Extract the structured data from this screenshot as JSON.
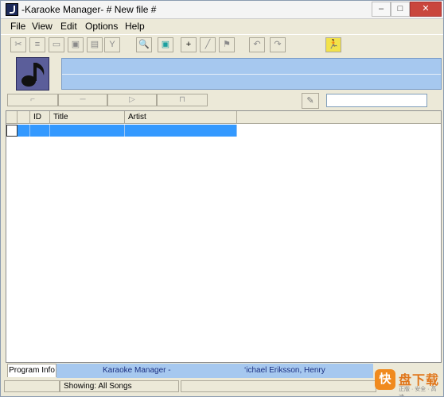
{
  "window": {
    "title": "-Karaoke Manager- # New file #",
    "controls": {
      "minimize": "–",
      "maximize": "□",
      "close": "✕"
    }
  },
  "menu": {
    "items": [
      {
        "label": "File"
      },
      {
        "label": "View"
      },
      {
        "label": "Edit"
      },
      {
        "label": "Options"
      },
      {
        "label": "Help"
      }
    ]
  },
  "toolbar": {
    "buttons": [
      "cut-icon",
      "tree-icon",
      "folder-icon",
      "folder-up-icon",
      "folder-edit-icon",
      "filter-icon",
      "search-icon",
      "monitor-icon",
      "add-icon",
      "line-icon",
      "flag-icon",
      "undo-icon",
      "redo-icon",
      "exit-icon"
    ]
  },
  "grid": {
    "columns": [
      {
        "label": ""
      },
      {
        "label": "ID"
      },
      {
        "label": "Title"
      },
      {
        "label": "Artist"
      }
    ],
    "selection_color": "#3399ff"
  },
  "search": {
    "value": ""
  },
  "status": {
    "program_info_tab": "Program Info",
    "ticker_left": "Karaoke Manager -",
    "ticker_right": "‘ichael Eriksson, Henry",
    "showing": "Showing: All Songs"
  },
  "watermark": {
    "badge": "快",
    "text": "盘下载",
    "subtitle": "正版 · 安全 · 高速"
  }
}
